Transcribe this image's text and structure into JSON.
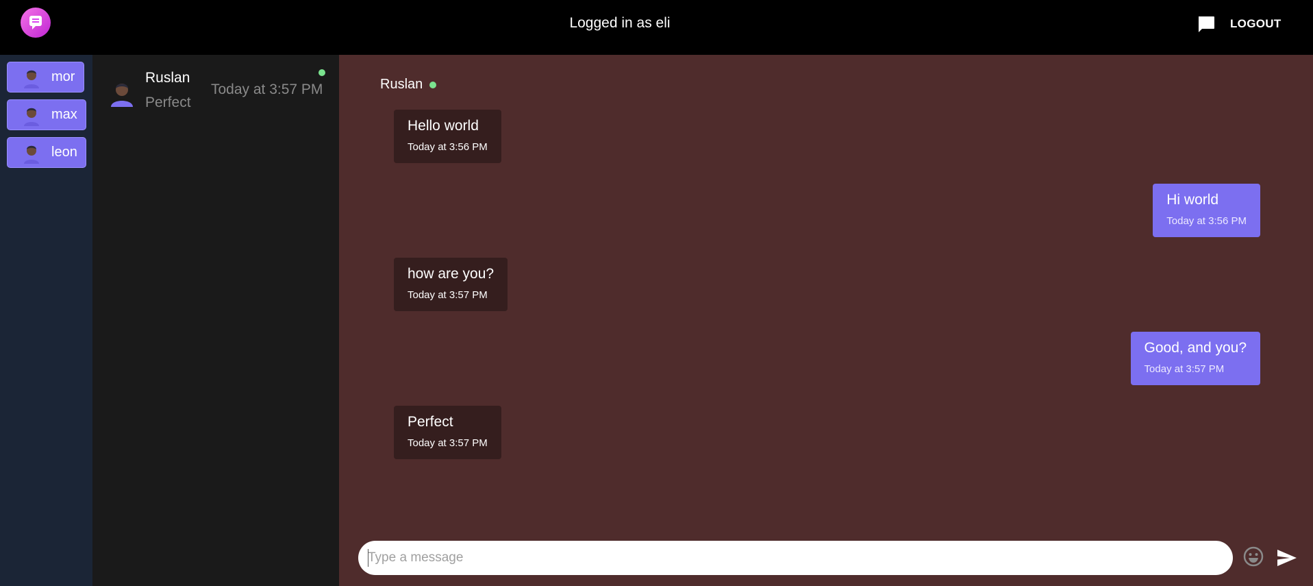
{
  "header": {
    "title": "Logged in as eli",
    "logo_icon": "chat-logo-icon",
    "chat_icon": "chat-bubble-icon",
    "logout_label": "LOGOUT"
  },
  "users": [
    {
      "label": "mor",
      "icon": "avatar-icon"
    },
    {
      "label": "max",
      "icon": "avatar-icon"
    },
    {
      "label": "leon",
      "icon": "avatar-icon"
    }
  ],
  "conversations": [
    {
      "name": "Ruslan",
      "last_message": "Perfect",
      "time": "Today at 3:57 PM",
      "online": true
    }
  ],
  "chat": {
    "contact_name": "Ruslan",
    "online": true,
    "messages": [
      {
        "direction": "in",
        "text": "Hello world",
        "time": "Today at 3:56 PM"
      },
      {
        "direction": "out",
        "text": "Hi world",
        "time": "Today at 3:56 PM"
      },
      {
        "direction": "in",
        "text": "how are you?",
        "time": "Today at 3:57 PM"
      },
      {
        "direction": "out",
        "text": "Good, and you?",
        "time": "Today at 3:57 PM"
      },
      {
        "direction": "in",
        "text": "Perfect",
        "time": "Today at 3:57 PM"
      }
    ]
  },
  "composer": {
    "placeholder": "Type a message",
    "value": "",
    "emoji_icon": "emoji-icon",
    "send_icon": "send-icon"
  },
  "colors": {
    "accent": "#7c6ff0",
    "online": "#7be38f",
    "chat_bg": "#4f2c2c",
    "incoming_bubble": "#351e1e",
    "sidebar_bg": "#1b2536",
    "list_bg": "#1a1a1a"
  }
}
